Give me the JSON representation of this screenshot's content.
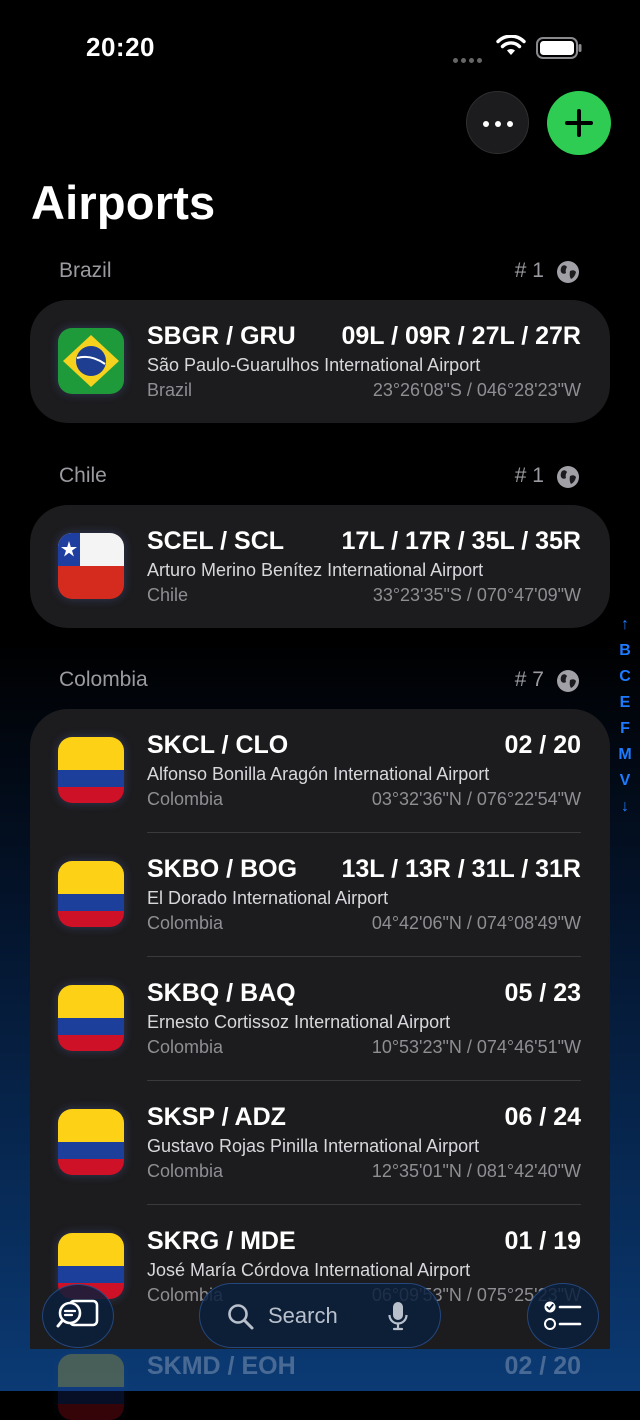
{
  "status_bar": {
    "time": "20:20"
  },
  "header": {
    "title": "Airports"
  },
  "sections": [
    {
      "name": "Brazil",
      "count": "# 1",
      "airports": [
        {
          "code": "SBGR / GRU",
          "runways": "09L / 09R / 27L / 27R",
          "name": "São Paulo-Guarulhos International Airport",
          "country": "Brazil",
          "coords": "23°26'08\"S / 046°28'23\"W",
          "flag": "brazil-flag"
        }
      ]
    },
    {
      "name": "Chile",
      "count": "# 1",
      "airports": [
        {
          "code": "SCEL / SCL",
          "runways": "17L / 17R / 35L / 35R",
          "name": "Arturo Merino Benítez International Airport",
          "country": "Chile",
          "coords": "33°23'35\"S / 070°47'09\"W",
          "flag": "chile-flag"
        }
      ]
    },
    {
      "name": "Colombia",
      "count": "# 7",
      "airports": [
        {
          "code": "SKCL / CLO",
          "runways": "02 / 20",
          "name": "Alfonso Bonilla Aragón International Airport",
          "country": "Colombia",
          "coords": "03°32'36\"N / 076°22'54\"W",
          "flag": "colombia-flag"
        },
        {
          "code": "SKBO / BOG",
          "runways": "13L / 13R / 31L / 31R",
          "name": "El Dorado International Airport",
          "country": "Colombia",
          "coords": "04°42'06\"N / 074°08'49\"W",
          "flag": "colombia-flag"
        },
        {
          "code": "SKBQ / BAQ",
          "runways": "05 / 23",
          "name": "Ernesto Cortissoz International Airport",
          "country": "Colombia",
          "coords": "10°53'23\"N / 074°46'51\"W",
          "flag": "colombia-flag"
        },
        {
          "code": "SKSP / ADZ",
          "runways": "06 / 24",
          "name": "Gustavo Rojas Pinilla International Airport",
          "country": "Colombia",
          "coords": "12°35'01\"N / 081°42'40\"W",
          "flag": "colombia-flag"
        },
        {
          "code": "SKRG / MDE",
          "runways": "01 / 19",
          "name": "José María Córdova International Airport",
          "country": "Colombia",
          "coords": "06°09'53\"N / 075°25'23\"W",
          "flag": "colombia-flag"
        },
        {
          "code": "SKMD / EOH",
          "runways": "02 / 20",
          "name": "",
          "country": "",
          "coords": "",
          "flag": "colombia-flag"
        }
      ]
    }
  ],
  "section_index": [
    "↑",
    "B",
    "C",
    "E",
    "F",
    "M",
    "V",
    "↓"
  ],
  "toolbar": {
    "search_placeholder": "Search",
    "left_icon": "search-reviews-icon",
    "right_icon": "checklist-icon",
    "mic_icon": "mic-icon"
  },
  "colors": {
    "accent_green": "#2ecc52",
    "index_blue": "#1e7bff",
    "card_bg": "#1c1c1e"
  }
}
